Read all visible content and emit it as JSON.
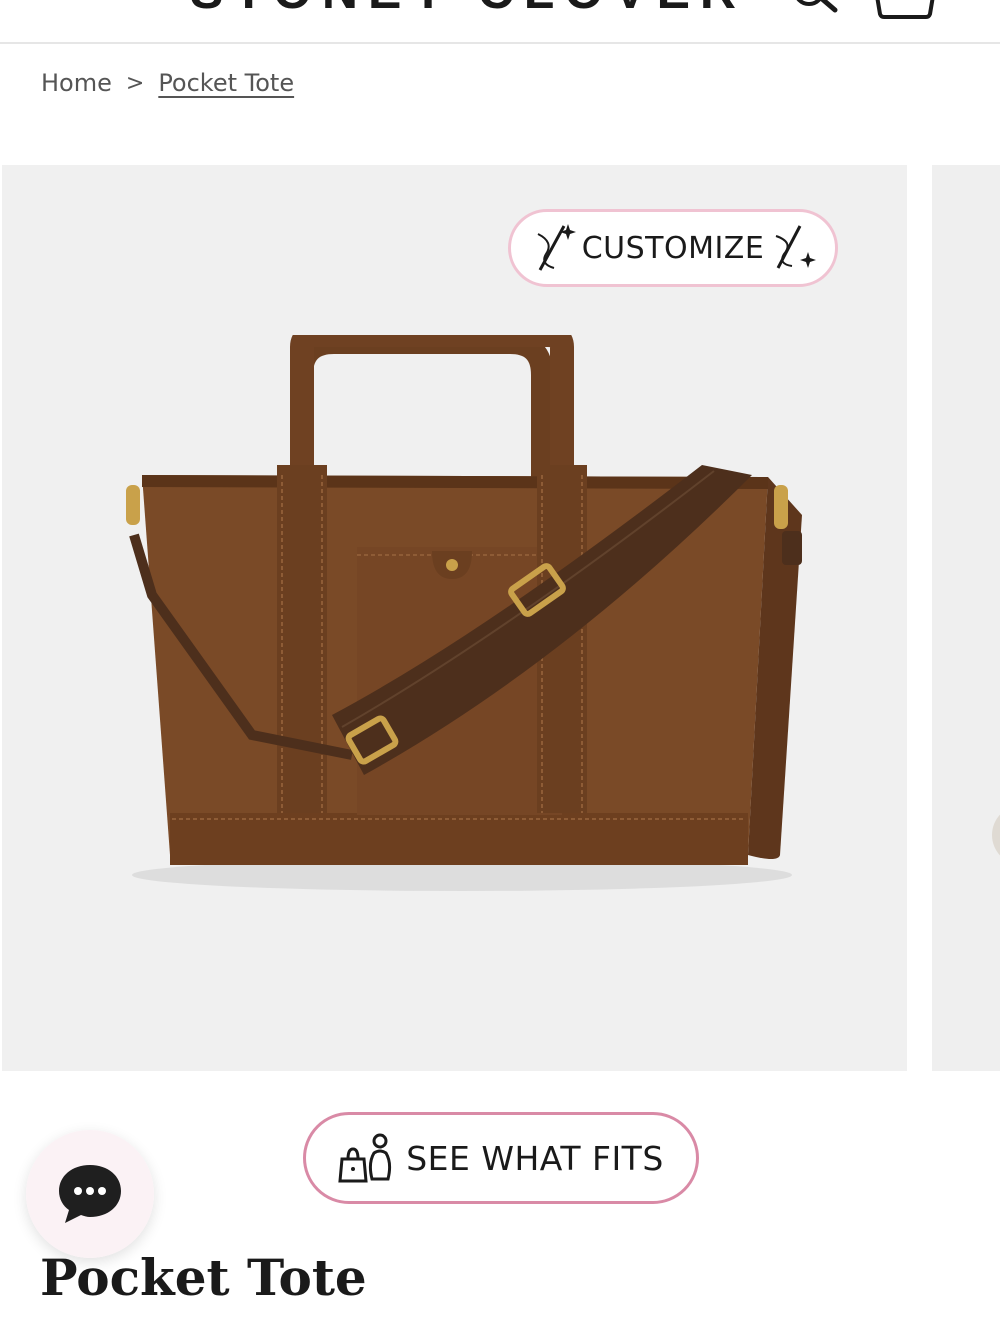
{
  "header": {
    "brand": "STONEY CLOVER LANE",
    "menu_icon": "hamburger-menu-icon",
    "search_icon": "search-icon",
    "cart_icon": "shopping-bag-icon"
  },
  "breadcrumb": {
    "home": "Home",
    "separator": ">",
    "current": "Pocket Tote"
  },
  "gallery": {
    "customize_label": "CUSTOMIZE",
    "customize_icon": "sparkle-needle-icon",
    "image_alt": "Pocket Tote",
    "colors": {
      "background": "#f0f0f0",
      "bag": "#7a4a27",
      "bag_dark": "#5e361c",
      "strap": "#5a3a24",
      "hardware": "#c9a14a"
    }
  },
  "fits": {
    "label": "SEE WHAT FITS",
    "icon": "bag-and-person-icon"
  },
  "chat": {
    "icon": "chat-bubble-icon"
  },
  "product": {
    "title": "Pocket Tote"
  },
  "theme": {
    "accent_pink": "#d98aa6",
    "accent_pink_light": "#f0c3d2",
    "text": "#1a1a1a"
  }
}
